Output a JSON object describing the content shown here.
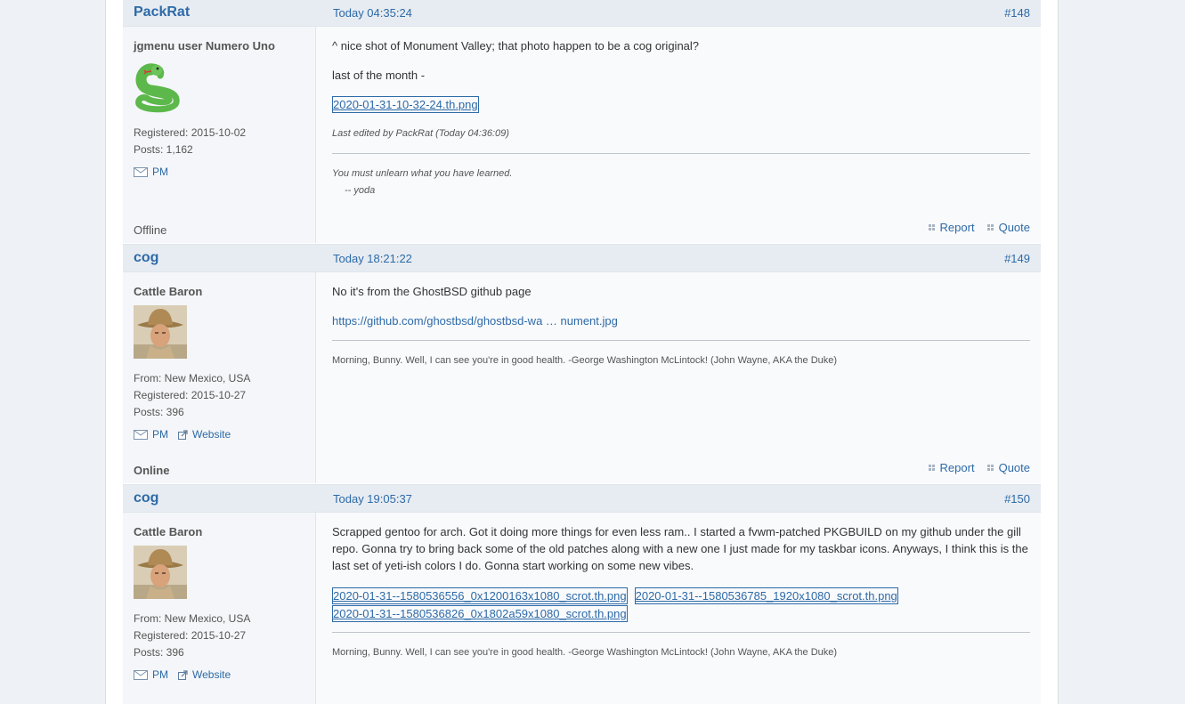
{
  "posts": [
    {
      "author": "PackRat",
      "date": "Today 04:35:24",
      "number": "#148",
      "user_title": "jgmenu user Numero Uno",
      "registered": "Registered: 2015-10-02",
      "posts": "Posts: 1,162",
      "pm_label": "PM",
      "status": "Offline",
      "paragraphs": [
        "^ nice shot of Monument Valley; that photo happen to be a cog original?",
        "last of the month -"
      ],
      "attachments": [
        "2020-01-31-10-32-24.th.png"
      ],
      "edited": "Last edited by PackRat (Today 04:36:09)",
      "signature": [
        "You must unlearn what you have learned.",
        "-- yoda"
      ],
      "report_label": "Report",
      "quote_label": "Quote",
      "avatar_icon": "snake-emoji"
    },
    {
      "author": "cog",
      "date": "Today 18:21:22",
      "number": "#149",
      "user_title": "Cattle Baron",
      "from": "From: New Mexico, USA",
      "registered": "Registered: 2015-10-27",
      "posts": "Posts: 396",
      "pm_label": "PM",
      "website_label": "Website",
      "status": "Online",
      "paragraphs": [
        "No it's from the GhostBSD github page"
      ],
      "link": "https://github.com/ghostbsd/ghostbsd-wa … nument.jpg",
      "signature": "Morning, Bunny.  Well, I can see you're in good health.  -George Washington McLintock! (John Wayne, AKA the Duke)",
      "report_label": "Report",
      "quote_label": "Quote",
      "avatar_icon": "cowboy-portrait"
    },
    {
      "author": "cog",
      "date": "Today 19:05:37",
      "number": "#150",
      "user_title": "Cattle Baron",
      "from": "From: New Mexico, USA",
      "registered": "Registered: 2015-10-27",
      "posts": "Posts: 396",
      "pm_label": "PM",
      "website_label": "Website",
      "paragraphs": [
        "Scrapped gentoo for arch.  Got it doing more things for even less ram..  I started a fvwm-patched PKGBUILD on my github under the gill repo.  Gonna try to bring back some of the old patches along with a new one I just made for my taskbar icons.  Anyways, I think this is the last set of yeti-ish colors I do.  Gonna start working on some new vibes."
      ],
      "attachments": [
        "2020-01-31--1580536556_0x1200163x1080_scrot.th.png",
        "2020-01-31--1580536785_1920x1080_scrot.th.png",
        "2020-01-31--1580536826_0x1802a59x1080_scrot.th.png"
      ],
      "signature": "Morning, Bunny.  Well, I can see you're in good health.  -George Washington McLintock! (John Wayne, AKA the Duke)",
      "avatar_icon": "cowboy-portrait"
    }
  ],
  "colors": {
    "link": "#2d6aa7",
    "header_bg": "#e7ecf2",
    "page_bg": "#eef2f7"
  }
}
